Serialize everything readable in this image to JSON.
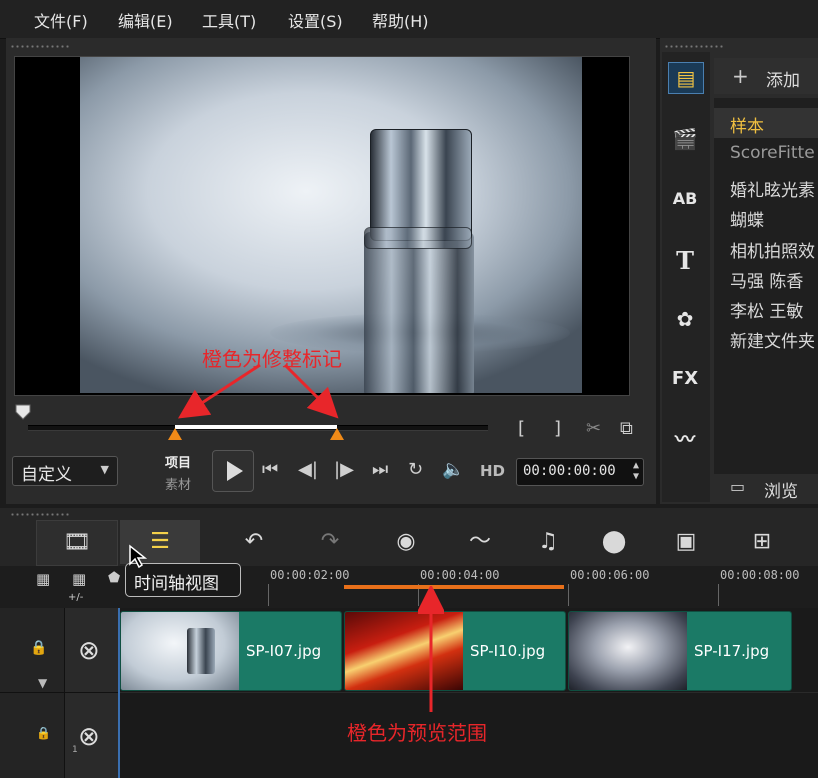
{
  "menu": {
    "items": [
      "文件(F)",
      "编辑(E)",
      "工具(T)",
      "设置(S)",
      "帮助(H)"
    ]
  },
  "preview": {
    "project_label": "项目",
    "clip_label": "素材",
    "mode_value": "自定义",
    "hd_label": "HD",
    "timecode": "00:00:00:00",
    "trim_start_mark": "[",
    "trim_end_mark": "]"
  },
  "annotations": {
    "trim_note": "橙色为修整标记",
    "range_note": "橙色为预览范围",
    "color": "#e8262a"
  },
  "library": {
    "add_label": "添加",
    "browse_label": "浏览",
    "items": [
      "样本",
      "ScoreFitte",
      "婚礼眩光素",
      "蝴蝶",
      "相机拍照效",
      "马强 陈香",
      "李松 王敏",
      "新建文件夹"
    ],
    "selected_color": "#f0c040"
  },
  "timeline": {
    "tooltip": "时间轴视图",
    "ruler_labels": [
      "00:00:02:00",
      "00:00:04:00",
      "00:00:06:00",
      "00:00:08:00"
    ],
    "add_remove_label": "+/-",
    "track_number": "1",
    "clips": [
      {
        "name": "SP-I07.jpg"
      },
      {
        "name": "SP-I10.jpg"
      },
      {
        "name": "SP-I17.jpg"
      }
    ],
    "clip_color": "#1b7a66",
    "range_color": "#e8701a"
  },
  "colors": {
    "trim_marker": "#f08a18",
    "accent": "#e8262a"
  }
}
